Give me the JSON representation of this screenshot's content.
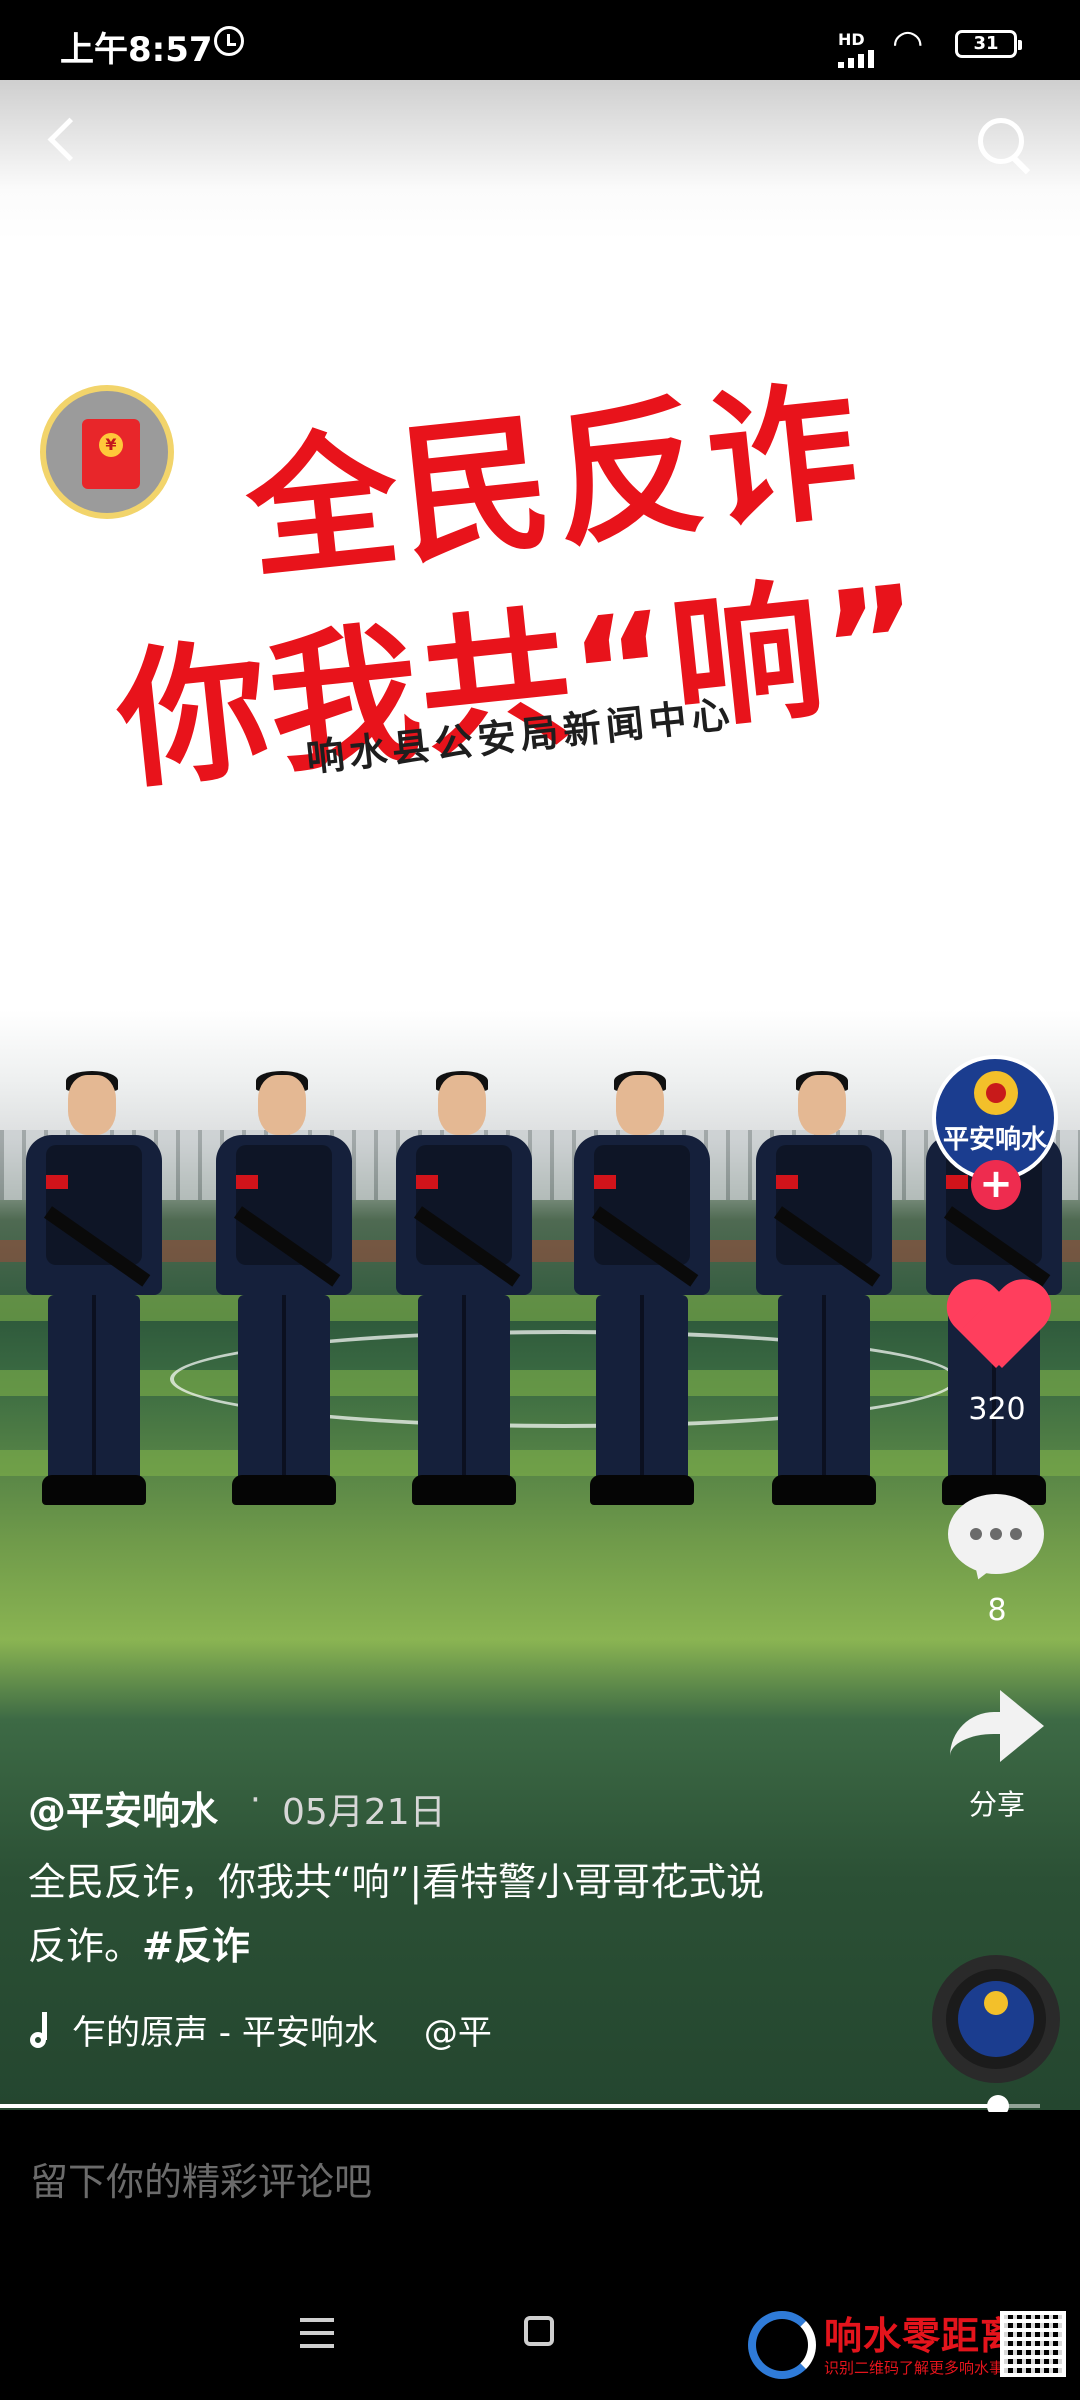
{
  "status_bar": {
    "time": "上午8:57",
    "network_label": "HD",
    "battery": "31"
  },
  "video": {
    "poster_title_line1": "全民反诈",
    "poster_title_line2": "你我共“响”",
    "poster_subtitle": "响水县公安局新闻中心",
    "accent_color": "#e8131b"
  },
  "side_actions": {
    "author_avatar_text": "平安响水",
    "follow_symbol": "+",
    "like_count": "320",
    "comment_count": "8",
    "share_label": "分享"
  },
  "caption": {
    "username": "@平安响水",
    "separator": "·",
    "date": "05月21日",
    "text": "全民反诈，你我共“响”|看特警小哥哥花式说反诈。",
    "hashtag": "#反诈"
  },
  "music": {
    "title": "乍的原声 - 平安响水",
    "mention": "@平"
  },
  "progress": {
    "fraction": 0.96
  },
  "comment_box": {
    "placeholder": "留下你的精彩评论吧"
  },
  "watermark": {
    "title": "响水零距离",
    "subtitle": "识别二维码了解更多响水事"
  }
}
